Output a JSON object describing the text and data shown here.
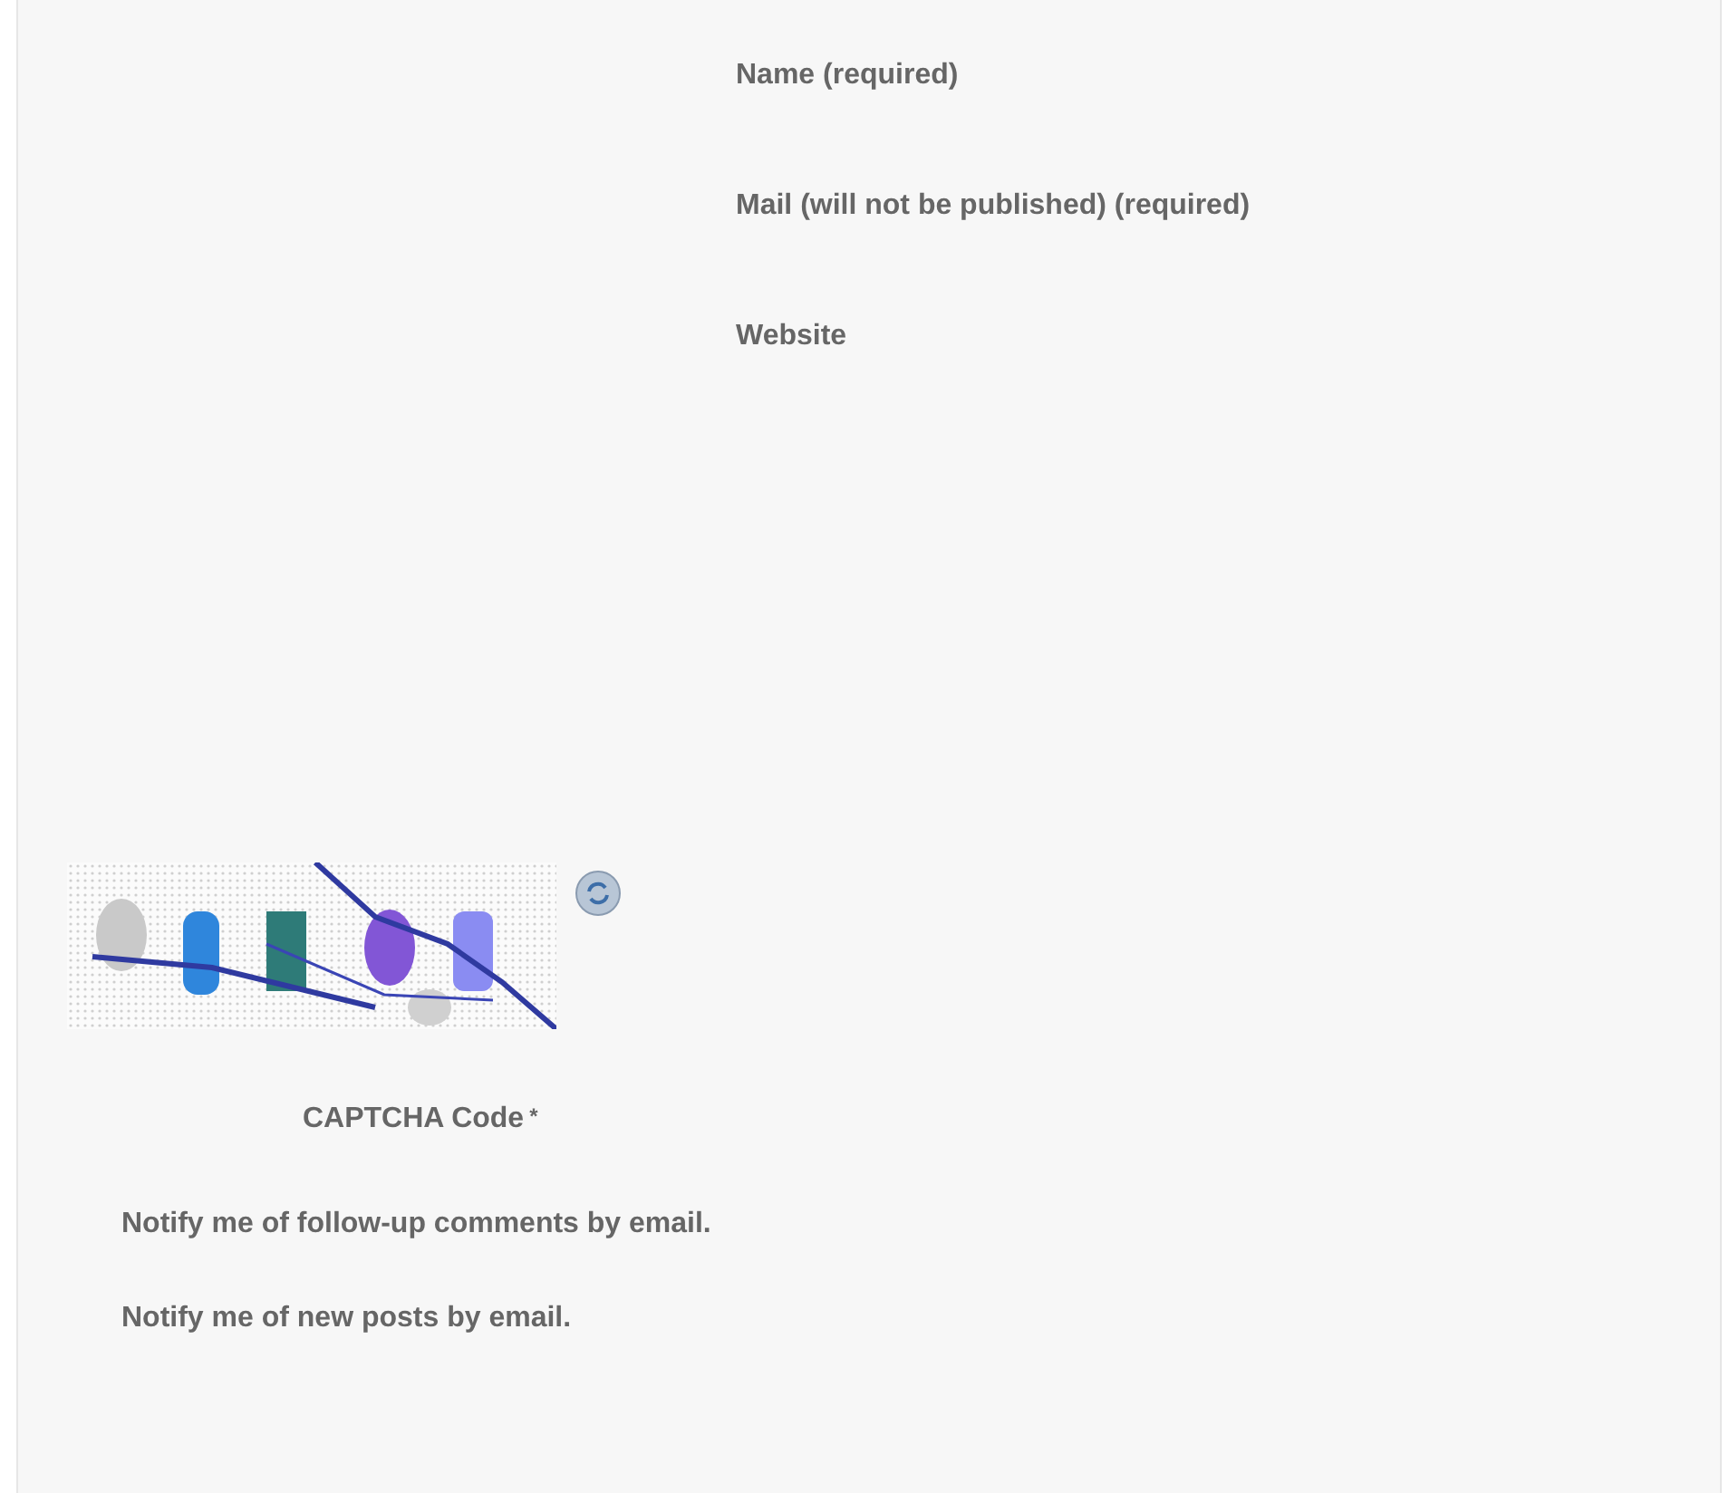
{
  "fields": [
    {
      "label": "Name (required)"
    },
    {
      "label": "Mail (will not be published) (required)"
    },
    {
      "label": "Website"
    }
  ],
  "captcha": {
    "label": "CAPTCHA Code",
    "required_mark": "*"
  },
  "notifications": [
    {
      "label": "Notify me of follow-up comments by email."
    },
    {
      "label": "Notify me of new posts by email."
    }
  ]
}
